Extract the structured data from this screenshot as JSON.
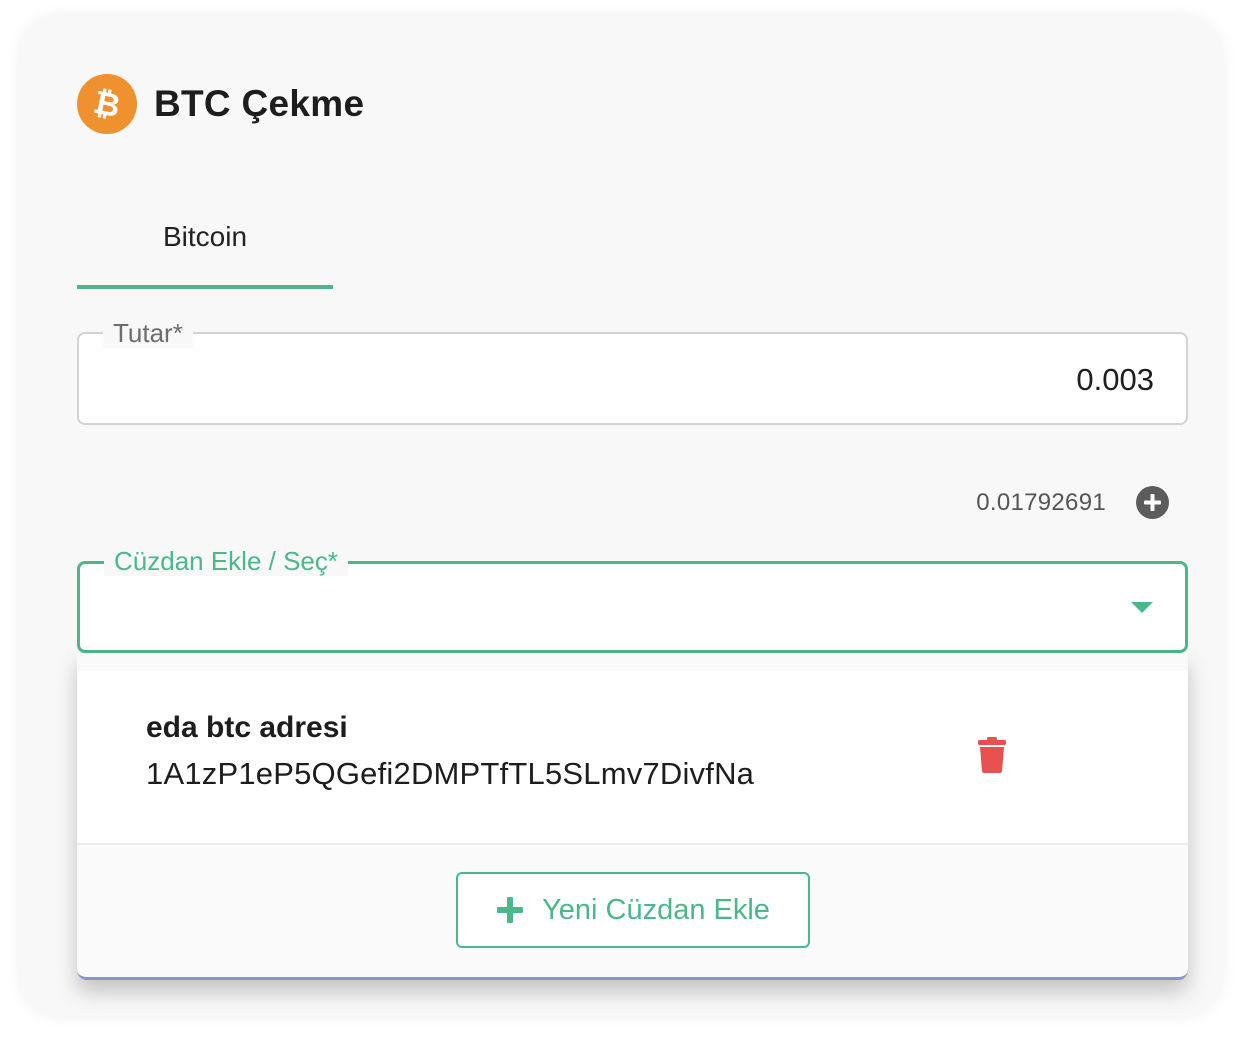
{
  "header": {
    "title": "BTC Çekme",
    "logo_icon": "bitcoin-icon",
    "logo_color": "#f0912f"
  },
  "tabs": [
    {
      "label": "Bitcoin",
      "active": true
    }
  ],
  "amount_field": {
    "label": "Tutar*",
    "value": "0.003"
  },
  "balance": {
    "value": "0.01792691",
    "icon": "plus-circle-icon"
  },
  "wallet_select": {
    "label": "Cüzdan Ekle / Seç*",
    "icon": "caret-down-icon",
    "options": [
      {
        "name": "eda btc adresi",
        "address": "1A1zP1eP5QGefi2DMPTfTL5SLmv7DivfNa",
        "icon": "trash-icon"
      }
    ],
    "add_button_label": "Yeni Cüzdan Ekle",
    "add_button_icon": "plus-icon"
  },
  "colors": {
    "accent": "#4ab88a",
    "danger": "#e8514f",
    "bitcoin": "#f0912f"
  }
}
